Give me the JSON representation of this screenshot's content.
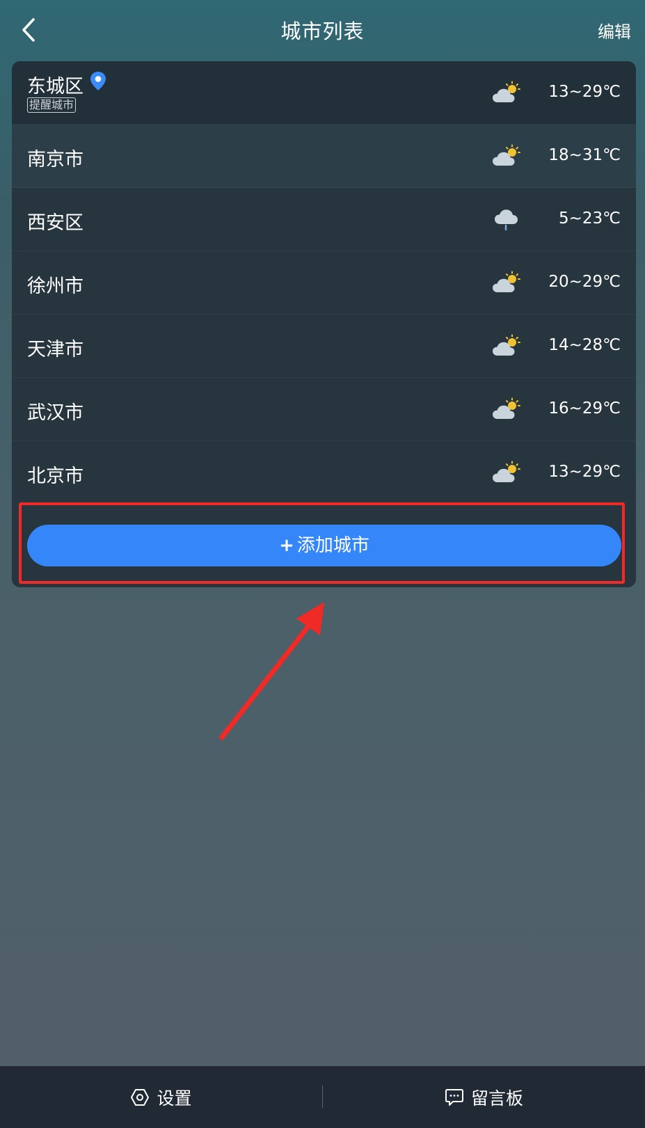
{
  "header": {
    "title": "城市列表",
    "edit_label": "编辑"
  },
  "cities": [
    {
      "name": "东城区",
      "tag": "提醒城市",
      "located": true,
      "weather_icon": "partly-cloudy-icon",
      "temp": "13~29℃"
    },
    {
      "name": "南京市",
      "weather_icon": "partly-cloudy-icon",
      "temp": "18~31℃"
    },
    {
      "name": "西安区",
      "weather_icon": "cloud-rain-icon",
      "temp": "5~23℃"
    },
    {
      "name": "徐州市",
      "weather_icon": "partly-cloudy-icon",
      "temp": "20~29℃"
    },
    {
      "name": "天津市",
      "weather_icon": "partly-cloudy-icon",
      "temp": "14~28℃"
    },
    {
      "name": "武汉市",
      "weather_icon": "partly-cloudy-icon",
      "temp": "16~29℃"
    },
    {
      "name": "北京市",
      "weather_icon": "partly-cloudy-icon",
      "temp": "13~29℃"
    }
  ],
  "add_city": {
    "plus": "+",
    "label": "添加城市"
  },
  "bottom_bar": {
    "settings_label": "设置",
    "message_board_label": "留言板"
  },
  "colors": {
    "accent": "#3587f9",
    "highlight": "#f02a26",
    "card": "#26353e",
    "bottom_bar": "#212a34"
  }
}
